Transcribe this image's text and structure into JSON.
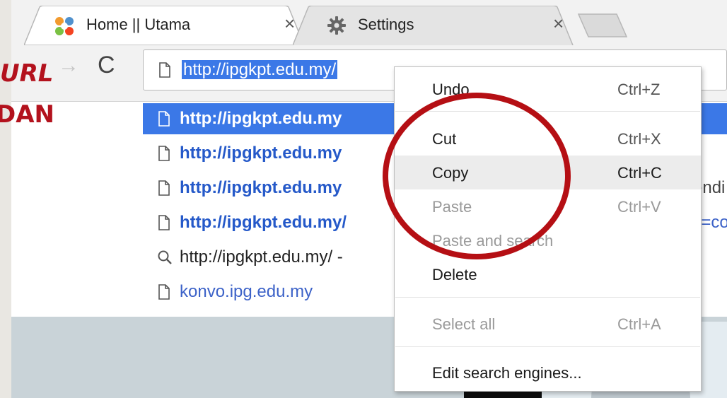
{
  "tabs": [
    {
      "title": "Home || Utama",
      "close": "×",
      "icon": "joomla-icon"
    },
    {
      "title": "Settings",
      "close": "×",
      "icon": "gear-icon"
    }
  ],
  "toolbar": {
    "forward": "→",
    "reload": "C",
    "url": "http://ipgkpt.edu.my/"
  },
  "suggestions": [
    {
      "text": "http://ipgkpt.edu.my",
      "icon": "page-icon",
      "selected": true,
      "extra": ""
    },
    {
      "text": "http://ipgkpt.edu.my",
      "icon": "page-icon",
      "selected": false,
      "extra": ""
    },
    {
      "text": "http://ipgkpt.edu.my",
      "icon": "page-icon",
      "selected": false,
      "extra": "endi"
    },
    {
      "text": "http://ipgkpt.edu.my/",
      "icon": "page-icon",
      "selected": false,
      "extra": "n=co"
    },
    {
      "text": "http://ipgkpt.edu.my/ -",
      "icon": "search-icon",
      "selected": false,
      "extra": ""
    },
    {
      "text": "konvo.ipg.edu.my",
      "icon": "page-icon",
      "selected": false,
      "extra": ""
    }
  ],
  "context_menu": {
    "items": [
      {
        "label": "Undo",
        "shortcut": "Ctrl+Z",
        "enabled": true
      },
      {
        "label": "Cut",
        "shortcut": "Ctrl+X",
        "enabled": true
      },
      {
        "label": "Copy",
        "shortcut": "Ctrl+C",
        "enabled": true,
        "highlighted": true
      },
      {
        "label": "Paste",
        "shortcut": "Ctrl+V",
        "enabled": false
      },
      {
        "label": "Paste and search",
        "shortcut": "",
        "enabled": false
      },
      {
        "label": "Delete",
        "shortcut": "",
        "enabled": true
      },
      {
        "label": "Select all",
        "shortcut": "Ctrl+A",
        "enabled": false
      },
      {
        "label": "Edit search engines...",
        "shortcut": "",
        "enabled": true
      }
    ]
  },
  "annotation": {
    "line1": "URL",
    "line2": "DAN",
    "color": "#b3121d"
  },
  "colors": {
    "selection": "#3b78e7",
    "link": "#2559c9",
    "highlight_ring": "#b50f14"
  }
}
